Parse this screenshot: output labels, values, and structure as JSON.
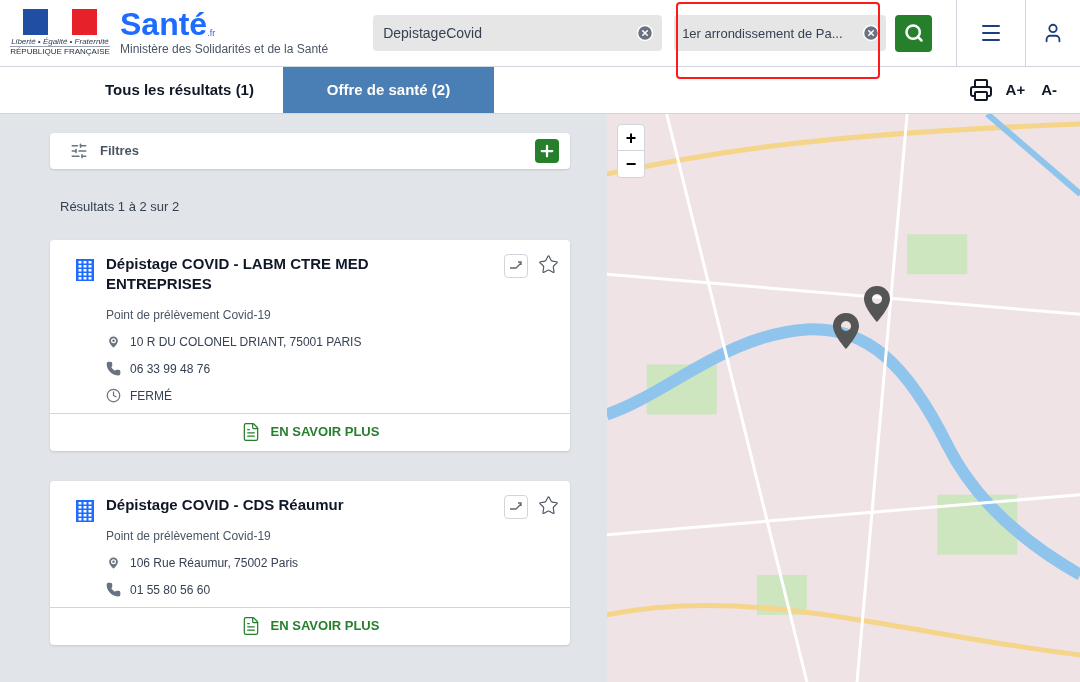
{
  "header": {
    "republic_motto": "Liberté • Égalité • Fraternité",
    "republic_name": "RÉPUBLIQUE FRANÇAISE",
    "brand": "Santé",
    "brand_suffix": ".fr",
    "ministry": "Ministère des Solidarités et de la Santé",
    "search_what": {
      "value": "DepistageCovid"
    },
    "search_where": {
      "value": "1er arrondissement de Pa..."
    }
  },
  "tabs": [
    {
      "label": "Tous les résultats (1)",
      "selected": false
    },
    {
      "label": "Offre de santé (2)",
      "selected": true
    }
  ],
  "text_tools": [
    "A+",
    "A-"
  ],
  "filters": {
    "label": "Filtres"
  },
  "results_count": "Résultats 1 à 2 sur 2",
  "results": [
    {
      "title": "Dépistage COVID - LABM CTRE MED ENTREPRISES",
      "category": "Point de prélèvement Covid-19",
      "lines": [
        {
          "kind": "address",
          "text": "10 R DU COLONEL DRIANT, 75001 PARIS"
        },
        {
          "kind": "phone",
          "text": "06 33 99 48 76"
        },
        {
          "kind": "hours",
          "text": "FERMÉ"
        }
      ],
      "more": "EN SAVOIR PLUS"
    },
    {
      "title": "Dépistage COVID - CDS Réaumur",
      "category": "Point de prélèvement Covid-19",
      "lines": [
        {
          "kind": "address",
          "text": "106 Rue Réaumur, 75002 Paris"
        },
        {
          "kind": "phone",
          "text": "01 55 80 56 60"
        }
      ],
      "more": "EN SAVOIR PLUS"
    }
  ],
  "map": {
    "zoom_in": "+",
    "zoom_out": "−"
  }
}
